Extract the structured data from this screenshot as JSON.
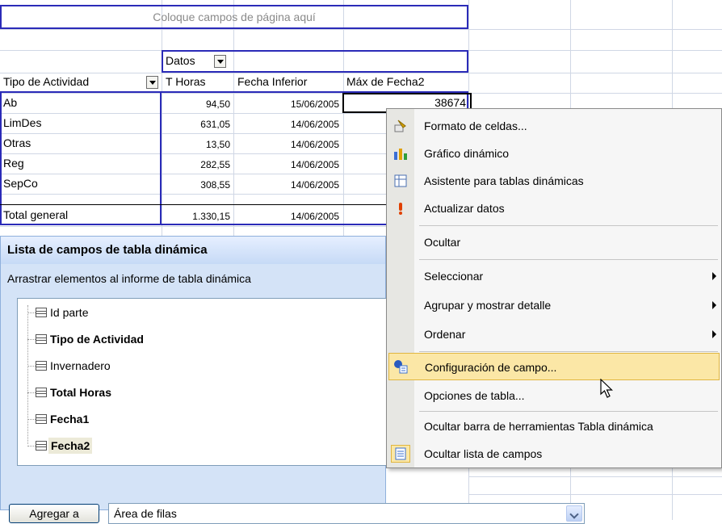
{
  "sheet": {
    "page_fields_prompt": "Coloque campos de página aquí",
    "data_label": "Datos",
    "header_col1": "Tipo de Actividad",
    "header_col2": "T Horas",
    "header_col3": "Fecha Inferior",
    "header_col4": "Máx de Fecha2",
    "rows": [
      {
        "name": "Ab",
        "horas": "94,50",
        "fecha": "15/06/2005",
        "max": "38674"
      },
      {
        "name": "LimDes",
        "horas": "631,05",
        "fecha": "14/06/2005",
        "max": ""
      },
      {
        "name": "Otras",
        "horas": "13,50",
        "fecha": "14/06/2005",
        "max": ""
      },
      {
        "name": "Reg",
        "horas": "282,55",
        "fecha": "14/06/2005",
        "max": ""
      },
      {
        "name": "SepCo",
        "horas": "308,55",
        "fecha": "14/06/2005",
        "max": ""
      }
    ],
    "total": {
      "name": "Total general",
      "horas": "1.330,15",
      "fecha": "14/06/2005"
    }
  },
  "field_list": {
    "title": "Lista de campos de tabla dinámica",
    "subtitle": "Arrastrar elementos al informe de tabla dinámica",
    "fields": [
      {
        "label": "Id parte",
        "bold": false
      },
      {
        "label": "Tipo de Actividad",
        "bold": true
      },
      {
        "label": "Invernadero",
        "bold": false
      },
      {
        "label": "Total Horas",
        "bold": true
      },
      {
        "label": "Fecha1",
        "bold": true
      },
      {
        "label": "Fecha2",
        "bold": true
      }
    ],
    "add_button": "Agregar a",
    "area_select": "Área de filas"
  },
  "context_menu": {
    "items": [
      {
        "label": "Formato de celdas...",
        "icon": "format-cells-icon"
      },
      {
        "label": "Gráfico dinámico",
        "icon": "pivot-chart-icon"
      },
      {
        "label": "Asistente para tablas dinámicas",
        "icon": "pivot-wizard-icon"
      },
      {
        "label": "Actualizar datos",
        "icon": "refresh-data-icon"
      },
      {
        "label": "Ocultar"
      },
      {
        "label": "Seleccionar",
        "submenu": true
      },
      {
        "label": "Agrupar y mostrar detalle",
        "submenu": true
      },
      {
        "label": "Ordenar",
        "submenu": true
      },
      {
        "label": "Configuración de campo...",
        "icon": "field-settings-icon",
        "highlighted": true
      },
      {
        "label": "Opciones de tabla..."
      },
      {
        "label": "Ocultar barra de herramientas Tabla dinámica"
      },
      {
        "label": "Ocultar lista de campos",
        "icon": "field-list-icon"
      }
    ]
  },
  "colors": {
    "pivot_border": "#2b2bb8",
    "menu_highlight": "#fbe7a6",
    "panel_bg": "#d4e3f7"
  }
}
